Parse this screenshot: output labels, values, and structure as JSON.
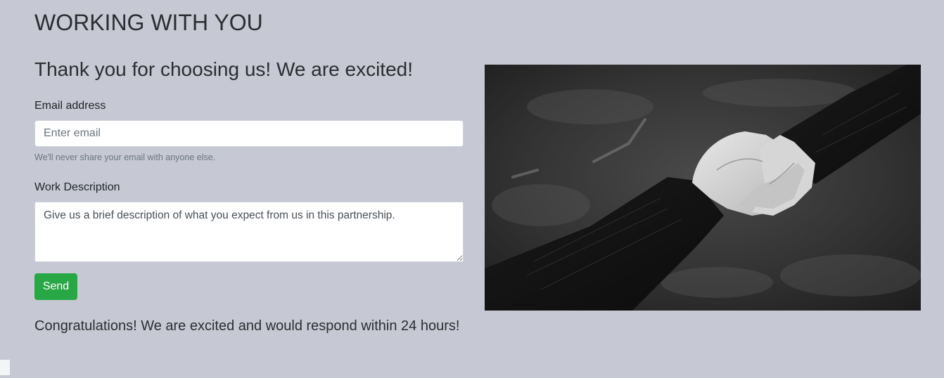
{
  "page": {
    "title": "WORKING WITH YOU"
  },
  "form": {
    "heading": "Thank you for choosing us! We are excited!",
    "email_label": "Email address",
    "email_placeholder": "Enter email",
    "email_value": "",
    "email_help": "We'll never share your email with anyone else.",
    "description_label": "Work Description",
    "description_placeholder": "Give us a brief description of what you expect from us in this partnership.",
    "description_value": "",
    "send_label": "Send",
    "confirmation": "Congratulations! We are excited and would respond within 24 hours!"
  },
  "image": {
    "subject": "black-and-white photo of two hands holding",
    "icon": "hands-holding-photo"
  },
  "colors": {
    "background": "#c6c9d3",
    "button": "#28a745",
    "text": "#2a2d31"
  }
}
